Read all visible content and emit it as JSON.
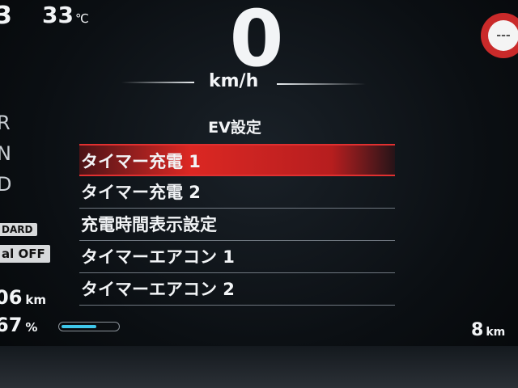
{
  "status": {
    "clipped_number": "3",
    "temperature": "33",
    "temperature_unit": "℃"
  },
  "speed": {
    "value": "0",
    "unit": "km/h"
  },
  "speed_sign": {
    "text": "---"
  },
  "gears": [
    "R",
    "N",
    "D"
  ],
  "badges": {
    "drive_mode": "DARD",
    "assist": "al OFF"
  },
  "range": {
    "value": "06",
    "unit": "km"
  },
  "battery": {
    "percent": "67",
    "unit": "%",
    "level": 0.62,
    "color": "#3fc7ea"
  },
  "trip": {
    "value": "8",
    "unit": "km"
  },
  "menu": {
    "title": "EV設定",
    "items": [
      {
        "label": "タイマー充電 1"
      },
      {
        "label": "タイマー充電 2"
      },
      {
        "label": "充電時間表示設定"
      },
      {
        "label": "タイマーエアコン 1"
      },
      {
        "label": "タイマーエアコン 2"
      }
    ],
    "selected_index": 0,
    "highlight_color": "#d62a2a"
  }
}
